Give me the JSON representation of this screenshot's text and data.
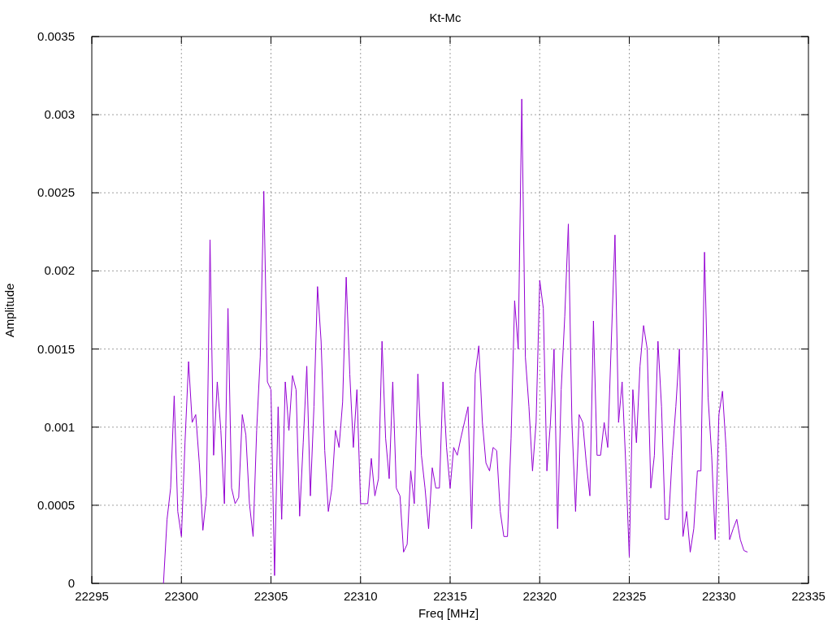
{
  "chart_data": {
    "type": "line",
    "title": "Kt-Mc",
    "xlabel": "Freq [MHz]",
    "ylabel": "Amplitude",
    "grid": true,
    "xlim": [
      22295,
      22335
    ],
    "ylim": [
      0,
      0.0035
    ],
    "xticks": [
      22295,
      22300,
      22305,
      22310,
      22315,
      22320,
      22325,
      22330,
      22335
    ],
    "yticks": [
      {
        "value": 0,
        "label": "0"
      },
      {
        "value": 0.0005,
        "label": "0.0005"
      },
      {
        "value": 0.001,
        "label": "0.001"
      },
      {
        "value": 0.0015,
        "label": "0.0015"
      },
      {
        "value": 0.002,
        "label": "0.002"
      },
      {
        "value": 0.0025,
        "label": "0.0025"
      },
      {
        "value": 0.003,
        "label": "0.003"
      },
      {
        "value": 0.0035,
        "label": "0.0035"
      }
    ],
    "x": [
      22299,
      22299.2,
      22299.4,
      22299.6,
      22299.8,
      22300,
      22300.2,
      22300.4,
      22300.6,
      22300.8,
      22301,
      22301.2,
      22301.4,
      22301.6,
      22301.8,
      22302,
      22302.2,
      22302.4,
      22302.6,
      22302.8,
      22303,
      22303.2,
      22303.4,
      22303.6,
      22303.8,
      22304,
      22304.2,
      22304.4,
      22304.6,
      22304.8,
      22305,
      22305.2,
      22305.4,
      22305.6,
      22305.8,
      22306,
      22306.2,
      22306.4,
      22306.6,
      22306.8,
      22307,
      22307.2,
      22307.4,
      22307.6,
      22307.8,
      22308,
      22308.2,
      22308.4,
      22308.6,
      22308.8,
      22309,
      22309.2,
      22309.4,
      22309.6,
      22309.8,
      22310,
      22310.2,
      22310.4,
      22310.6,
      22310.8,
      22311,
      22311.2,
      22311.4,
      22311.6,
      22311.8,
      22312,
      22312.2,
      22312.4,
      22312.6,
      22312.8,
      22313,
      22313.2,
      22313.4,
      22313.6,
      22313.8,
      22314,
      22314.2,
      22314.4,
      22314.6,
      22314.8,
      22315,
      22315.2,
      22315.4,
      22315.6,
      22315.8,
      22316,
      22316.2,
      22316.4,
      22316.6,
      22316.8,
      22317,
      22317.2,
      22317.4,
      22317.6,
      22317.8,
      22318,
      22318.2,
      22318.4,
      22318.6,
      22318.8,
      22319,
      22319.2,
      22319.4,
      22319.6,
      22319.8,
      22320,
      22320.2,
      22320.4,
      22320.6,
      22320.8,
      22321,
      22321.2,
      22321.4,
      22321.6,
      22321.8,
      22322,
      22322.2,
      22322.4,
      22322.6,
      22322.8,
      22323,
      22323.2,
      22323.4,
      22323.6,
      22323.8,
      22324,
      22324.2,
      22324.4,
      22324.6,
      22324.8,
      22325,
      22325.2,
      22325.4,
      22325.6,
      22325.8,
      22326,
      22326.2,
      22326.4,
      22326.6,
      22326.8,
      22327,
      22327.2,
      22327.4,
      22327.6,
      22327.8,
      22328,
      22328.2,
      22328.4,
      22328.6,
      22328.8,
      22329,
      22329.2,
      22329.4,
      22329.6,
      22329.8,
      22330,
      22330.2,
      22330.4,
      22330.6,
      22330.8,
      22331,
      22331.2,
      22331.4,
      22331.6
    ],
    "series": [
      {
        "color": "#9400d3",
        "values": [
          0,
          0.00041,
          0.00061,
          0.0012,
          0.00046,
          0.0003,
          0.0009,
          0.00142,
          0.00103,
          0.00108,
          0.00077,
          0.00034,
          0.00056,
          0.0022,
          0.00082,
          0.00129,
          0.00098,
          0.00051,
          0.00176,
          0.00061,
          0.00051,
          0.00055,
          0.00108,
          0.00095,
          0.00051,
          0.0003,
          0.00098,
          0.00145,
          0.00251,
          0.00129,
          0.00124,
          5e-05,
          0.00113,
          0.00041,
          0.00129,
          0.00098,
          0.00133,
          0.00124,
          0.00043,
          0.0009,
          0.00139,
          0.00056,
          0.00113,
          0.0019,
          0.00155,
          0.00085,
          0.00046,
          0.00061,
          0.00098,
          0.00087,
          0.00116,
          0.00196,
          0.00134,
          0.00087,
          0.00124,
          0.00051,
          0.00051,
          0.00051,
          0.0008,
          0.00056,
          0.00067,
          0.00155,
          0.00093,
          0.00067,
          0.00129,
          0.00061,
          0.00056,
          0.0002,
          0.00025,
          0.00072,
          0.00051,
          0.00134,
          0.00082,
          0.00061,
          0.00035,
          0.00074,
          0.00061,
          0.00061,
          0.00129,
          0.00087,
          0.00061,
          0.00087,
          0.00082,
          0.00093,
          0.00103,
          0.00113,
          0.00035,
          0.00134,
          0.00152,
          0.00103,
          0.00077,
          0.00072,
          0.00087,
          0.00085,
          0.00046,
          0.0003,
          0.0003,
          0.00093,
          0.00181,
          0.0015,
          0.0031,
          0.00145,
          0.00113,
          0.00072,
          0.00103,
          0.00194,
          0.00176,
          0.00072,
          0.00103,
          0.0015,
          0.00035,
          0.00124,
          0.00171,
          0.0023,
          0.00103,
          0.00046,
          0.00108,
          0.00103,
          0.00077,
          0.00056,
          0.00168,
          0.00082,
          0.00082,
          0.00103,
          0.00087,
          0.00155,
          0.00223,
          0.00103,
          0.00129,
          0.00077,
          0.00017,
          0.00124,
          0.0009,
          0.00139,
          0.00165,
          0.0015,
          0.00061,
          0.00082,
          0.00155,
          0.00113,
          0.00041,
          0.00041,
          0.00082,
          0.00113,
          0.0015,
          0.0003,
          0.00046,
          0.0002,
          0.00035,
          0.00072,
          0.00072,
          0.00212,
          0.00119,
          0.00082,
          0.00028,
          0.00108,
          0.00123,
          0.00087,
          0.00028,
          0.00035,
          0.00041,
          0.00028,
          0.00021,
          0.0002
        ]
      }
    ]
  }
}
